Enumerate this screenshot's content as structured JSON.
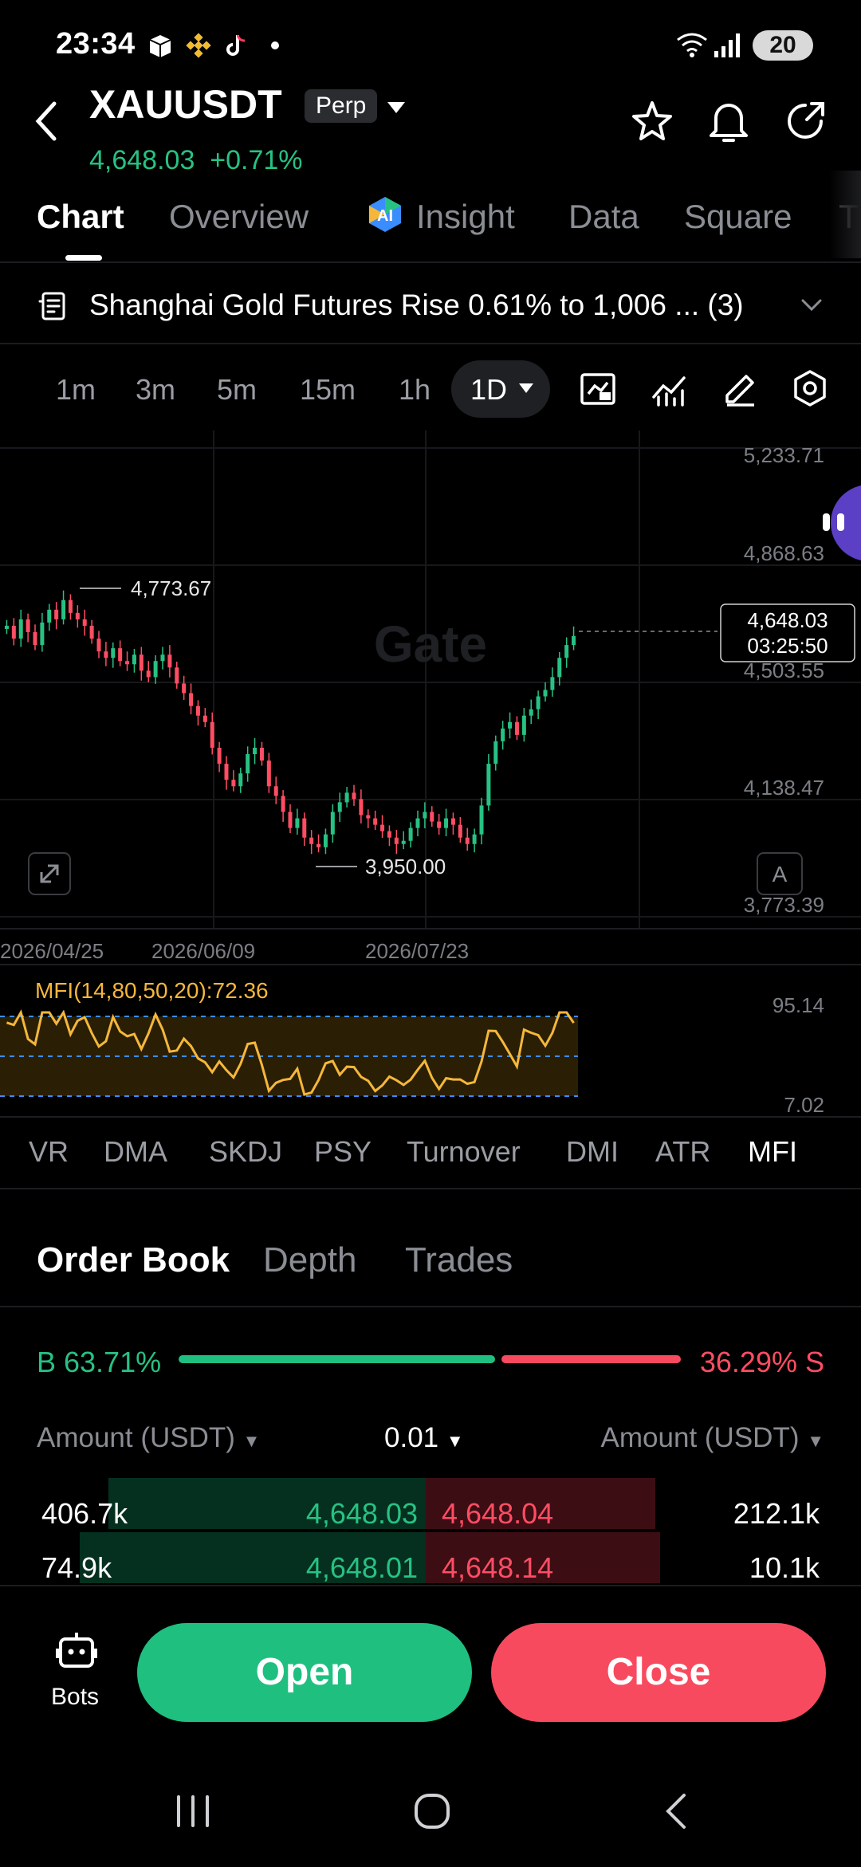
{
  "status": {
    "time": "23:34",
    "battery": "20"
  },
  "header": {
    "symbol": "XAUUSDT",
    "badge": "Perp",
    "price": "4,648.03",
    "change": "+0.71%"
  },
  "tabs": [
    {
      "label": "Chart",
      "active": true
    },
    {
      "label": "Overview"
    },
    {
      "label": "Insight"
    },
    {
      "label": "Data"
    },
    {
      "label": "Square"
    },
    {
      "label": "T"
    }
  ],
  "news": {
    "text": "Shanghai Gold Futures Rise 0.61% to 1,006 ... (3)"
  },
  "intervals": [
    "1m",
    "3m",
    "5m",
    "15m",
    "1h",
    "1D"
  ],
  "chart": {
    "watermark": "Gate",
    "y_ticks": [
      "5,233.71",
      "4,868.63",
      "4,503.55",
      "4,138.47",
      "3,773.39"
    ],
    "x_ticks": [
      "2026/04/25",
      "2026/06/09",
      "2026/07/23"
    ],
    "high_label": "4,773.67",
    "low_label": "3,950.00",
    "last_price": "4,648.03",
    "countdown": "03:25:50",
    "auto_label": "A"
  },
  "indicator": {
    "label": "MFI(14,80,50,20):72.36",
    "top_tick": "95.14",
    "bottom_tick": "7.02"
  },
  "indicator_tabs": [
    "VR",
    "DMA",
    "SKDJ",
    "PSY",
    "Turnover",
    "DMI",
    "ATR",
    "MFI"
  ],
  "order_book": {
    "tabs": [
      "Order Book",
      "Depth",
      "Trades"
    ],
    "buy_pct": "B 63.71%",
    "sell_pct": "36.29% S",
    "buy_ratio": 0.6371,
    "amount_left": "Amount (USDT)",
    "precision": "0.01",
    "amount_right": "Amount (USDT)",
    "rows": [
      {
        "bid_amt": "406.7k",
        "bid": "4,648.03",
        "ask": "4,648.04",
        "ask_amt": "212.1k"
      },
      {
        "bid_amt": "74.9k",
        "bid": "4,648.01",
        "ask": "4,648.14",
        "ask_amt": "10.1k"
      }
    ]
  },
  "bottom": {
    "bots": "Bots",
    "open": "Open",
    "close": "Close"
  },
  "colors": {
    "up": "#27c283",
    "down": "#ff4d63",
    "mfi": "#f5b73b"
  },
  "chart_data": {
    "type": "candlestick",
    "ylim": [
      3773.39,
      5233.71
    ],
    "x_ticks": [
      "2026/04/25",
      "2026/06/09",
      "2026/07/23"
    ],
    "close_series": [
      4680,
      4640,
      4700,
      4660,
      4620,
      4690,
      4730,
      4700,
      4760,
      4720,
      4700,
      4680,
      4640,
      4600,
      4580,
      4610,
      4570,
      4560,
      4590,
      4540,
      4520,
      4570,
      4590,
      4550,
      4500,
      4470,
      4430,
      4400,
      4380,
      4300,
      4250,
      4200,
      4180,
      4220,
      4280,
      4300,
      4260,
      4180,
      4150,
      4100,
      4050,
      4080,
      4020,
      4000,
      3990,
      4030,
      4100,
      4130,
      4160,
      4140,
      4090,
      4080,
      4060,
      4040,
      4020,
      4000,
      4010,
      4050,
      4080,
      4100,
      4070,
      4050,
      4080,
      4060,
      4020,
      4000,
      4030,
      4120,
      4250,
      4320,
      4360,
      4380,
      4340,
      4400,
      4420,
      4460,
      4480,
      4520,
      4580,
      4620,
      4648
    ]
  }
}
